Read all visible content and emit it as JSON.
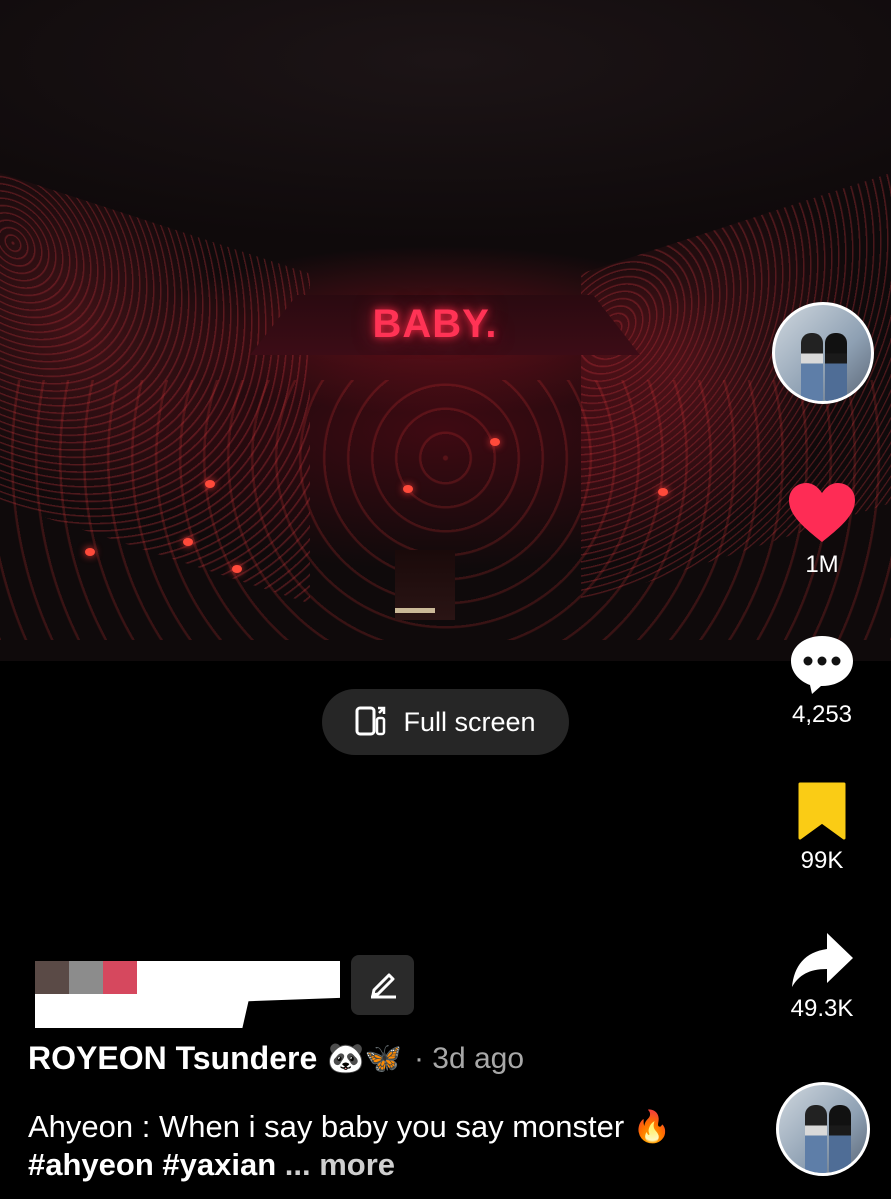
{
  "video": {
    "stage_text": "BABY."
  },
  "player": {
    "fullscreen_label": "Full screen"
  },
  "rail": {
    "like_count": "1M",
    "comment_count": "4,253",
    "bookmark_count": "99K",
    "share_count": "49.3K"
  },
  "post": {
    "author": "ROYEON Tsundere",
    "author_emojis": "🐼🦋",
    "time_ago": "· 3d ago",
    "caption_text": "Ahyeon : When i say baby you say monster",
    "caption_emoji": "🔥",
    "hashtags": [
      "#ahyeon",
      "#yaxian"
    ],
    "more_label": "... more"
  },
  "colors": {
    "like": "#fe2c55",
    "bookmark": "#facc15",
    "background": "#000000",
    "pill": "#262626"
  },
  "swatches": [
    "#5a4a46",
    "#8c8c8c",
    "#d6485e"
  ]
}
